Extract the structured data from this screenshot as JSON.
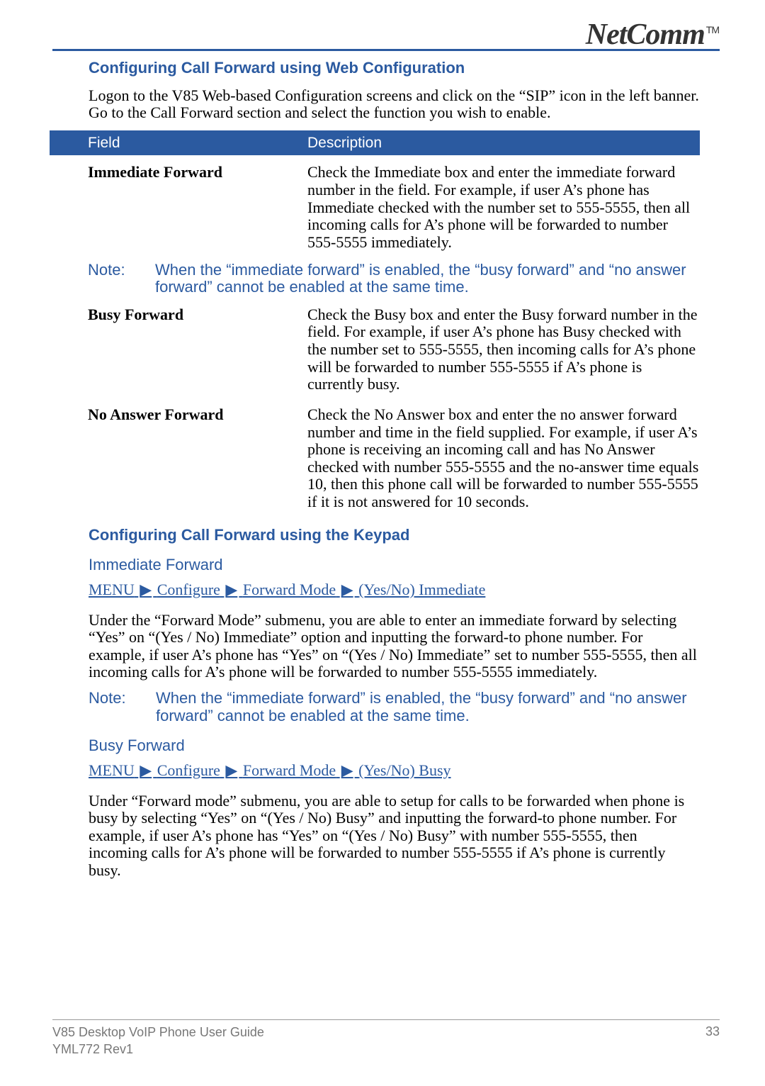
{
  "brand": {
    "name": "NetComm",
    "tm": "TM"
  },
  "sections": {
    "web_config": {
      "heading": "Configuring Call Forward using Web Configuration",
      "intro": "Logon to the V85 Web-based Configuration screens and click on the “SIP” icon in the left banner.  Go to the Call Forward section and select the function you wish to enable.",
      "table": {
        "headers": {
          "field": "Field",
          "description": "Description"
        },
        "rows": [
          {
            "field": "Immediate Forward",
            "desc": "Check the Immediate box and enter the immediate forward number in the field. For example, if user A’s phone has Immediate checked with the number set to 555-5555, then all incoming calls for A’s phone will be forwarded to number 555-5555 immediately."
          },
          {
            "field": "Busy Forward",
            "desc": "Check the Busy box and enter the Busy forward number in the field. For example, if user A’s phone has Busy checked with the number set to 555-5555, then incoming calls for A’s phone will be forwarded to number 555-5555 if A’s phone is currently busy."
          },
          {
            "field": "No Answer Forward",
            "desc": "Check the No Answer box and enter the no answer forward number and time in the field supplied. For example, if user A’s phone is receiving an incoming call and has No Answer checked with number 555-5555 and the no-answer time equals 10, then this phone call will be forwarded to number 555-5555 if it is not answered for 10 seconds."
          }
        ],
        "note": {
          "label": "Note:",
          "text": "When the “immediate forward” is enabled, the “busy forward” and “no answer forward” cannot be enabled at the same time."
        }
      }
    },
    "keypad": {
      "heading": "Configuring Call Forward using the Keypad",
      "immediate": {
        "heading": "Immediate Forward",
        "menu": [
          "MENU",
          "Configure",
          "Forward Mode",
          "(Yes/No) Immediate"
        ],
        "body": "Under the “Forward Mode” submenu, you are able to enter an immediate forward by selecting “Yes” on “(Yes / No) Immediate” option and inputting the forward-to phone number. For example, if user A’s phone has “Yes” on “(Yes / No) Immediate” set to number 555-5555, then all incoming calls for A’s phone will be forwarded to number 555-5555 immediately.",
        "note": {
          "label": "Note:",
          "text": "When the “immediate forward” is enabled, the “busy forward” and “no answer forward” cannot be enabled at the same time."
        }
      },
      "busy": {
        "heading": "Busy Forward",
        "menu": [
          "MENU",
          "Configure",
          "Forward Mode",
          "(Yes/No) Busy"
        ],
        "body": "Under “Forward mode” submenu, you are able to setup for calls to be forwarded when phone is busy by selecting “Yes” on “(Yes / No) Busy” and inputting the forward-to phone number. For example, if user A’s phone has “Yes” on “(Yes / No) Busy” with number 555-5555, then incoming calls for A’s phone will be forwarded to number 555-5555 if A’s phone is currently busy."
      }
    }
  },
  "footer": {
    "title": "V85 Desktop VoIP Phone User Guide",
    "rev": "YML772 Rev1",
    "page": "33"
  },
  "glyphs": {
    "arrow": "▶"
  }
}
